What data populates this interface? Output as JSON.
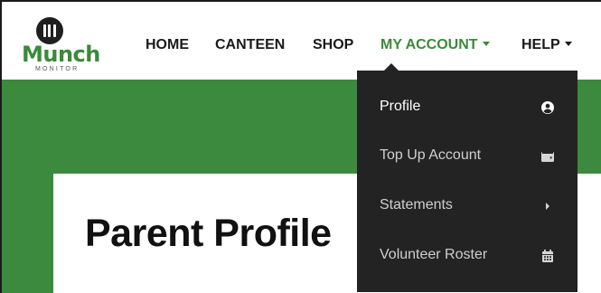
{
  "brand": {
    "logo_word": "Munch",
    "logo_sub": "MONITOR",
    "green": "#3b8a3d",
    "dark": "#232323"
  },
  "nav": {
    "home": "HOME",
    "canteen": "CANTEEN",
    "shop": "SHOP",
    "my_account": "MY ACCOUNT",
    "help": "HELP"
  },
  "account_menu": {
    "items": [
      {
        "label": "Profile",
        "icon": "user-circle-icon"
      },
      {
        "label": "Top Up Account",
        "icon": "wallet-icon"
      },
      {
        "label": "Statements",
        "icon": "chevron-right-icon"
      },
      {
        "label": "Volunteer Roster",
        "icon": "calendar-icon"
      }
    ]
  },
  "page": {
    "title": "Parent Profile"
  }
}
